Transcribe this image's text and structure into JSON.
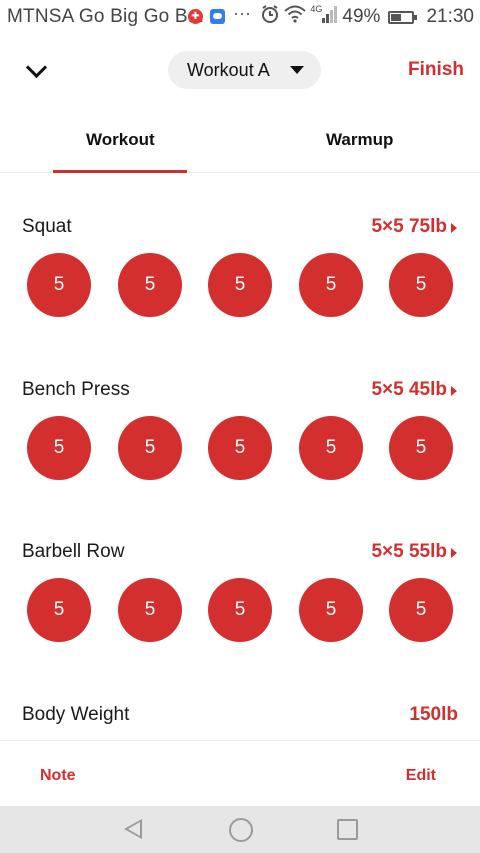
{
  "status_bar": {
    "carrier": "MTNSA Go Big Go B...",
    "more": "···",
    "network": "4G",
    "battery": "49%",
    "time": "21:30",
    "icons": [
      "notification-red-icon",
      "messenger-icon",
      "alarm-icon",
      "wifi-icon",
      "signal-icon",
      "battery-icon"
    ]
  },
  "header": {
    "workout_name": "Workout A",
    "finish_label": "Finish"
  },
  "tabs": [
    {
      "label": "Workout",
      "active": true
    },
    {
      "label": "Warmup",
      "active": false
    }
  ],
  "exercises": [
    {
      "name": "Squat",
      "scheme": "5×5 75lb",
      "sets": [
        "5",
        "5",
        "5",
        "5",
        "5"
      ]
    },
    {
      "name": "Bench Press",
      "scheme": "5×5 45lb",
      "sets": [
        "5",
        "5",
        "5",
        "5",
        "5"
      ]
    },
    {
      "name": "Barbell Row",
      "scheme": "5×5 55lb",
      "sets": [
        "5",
        "5",
        "5",
        "5",
        "5"
      ]
    }
  ],
  "body_weight": {
    "label": "Body Weight",
    "value": "150lb"
  },
  "actions": {
    "note_label": "Note",
    "edit_label": "Edit"
  },
  "colors": {
    "accent": "#d32f2f",
    "pill_bg": "#efefef",
    "nav_bg": "#e6e6e6"
  }
}
